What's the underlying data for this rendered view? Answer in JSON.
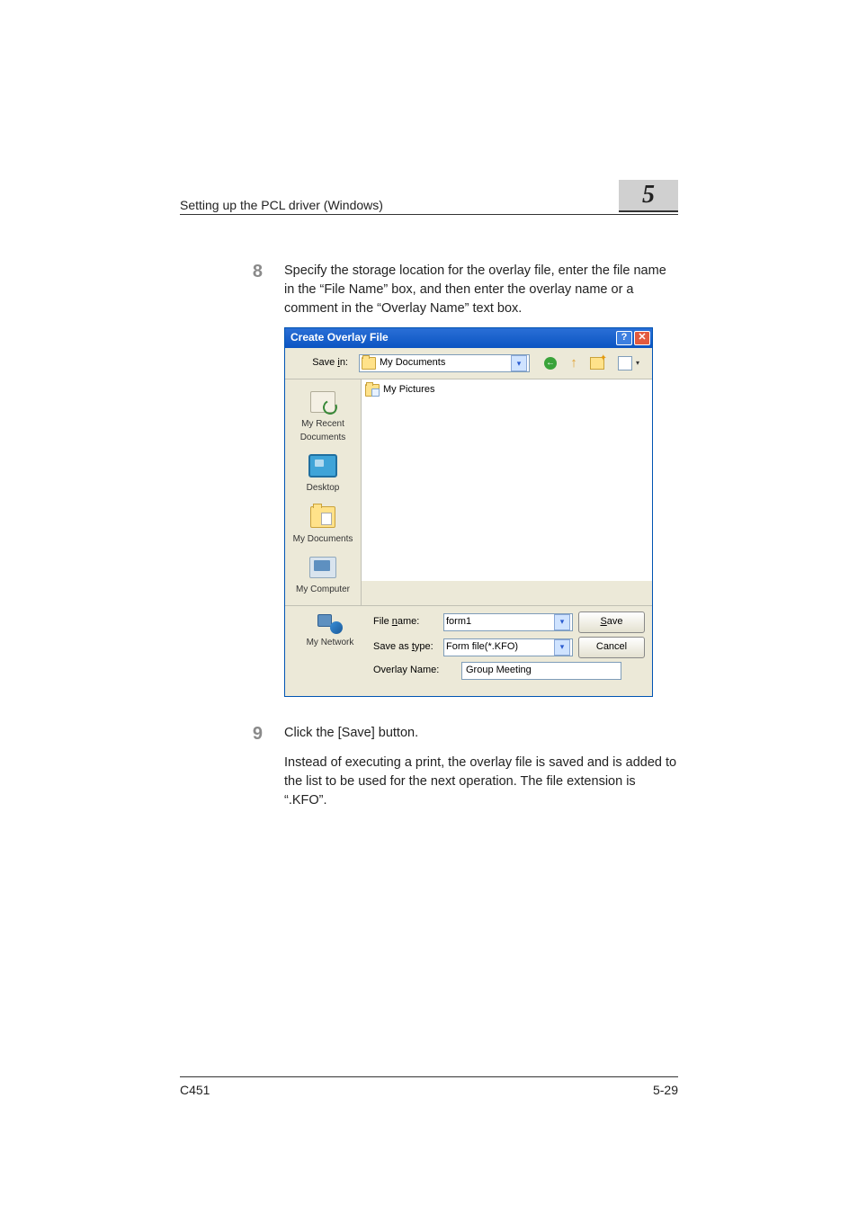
{
  "header": {
    "title": "Setting up the PCL driver (Windows)",
    "chapter_number": "5"
  },
  "steps": {
    "s8": {
      "num": "8",
      "text": "Specify the storage location for the overlay file, enter the file name in the “File Name” box, and then enter the overlay name or a comment in the “Overlay Name” text box."
    },
    "s9": {
      "num": "9",
      "text": "Click the [Save] button.",
      "sub": "Instead of executing a print, the overlay file is saved and is added to the list to be used for the next operation. The file extension is “.KFO”."
    }
  },
  "dialog": {
    "title": "Create Overlay File",
    "help_glyph": "?",
    "close_glyph": "✕",
    "save_in_label": "Save in:",
    "save_in_value": "My Documents",
    "back_glyph": "←",
    "up_glyph": "↑",
    "dropdown_glyph": "▾",
    "places": {
      "recent": "My Recent Documents",
      "desktop": "Desktop",
      "documents": "My Documents",
      "computer": "My Computer",
      "network": "My Network"
    },
    "filelist": {
      "item1": "My Pictures"
    },
    "filename_label": "File name:",
    "filename_value": "form1",
    "savetype_label": "Save as type:",
    "savetype_value": "Form file(*.KFO)",
    "overlayname_label": "Overlay Name:",
    "overlayname_value": "Group Meeting",
    "save_btn_u": "S",
    "save_btn_rest": "ave",
    "cancel_btn": "Cancel"
  },
  "footer": {
    "left": "C451",
    "right": "5-29"
  }
}
